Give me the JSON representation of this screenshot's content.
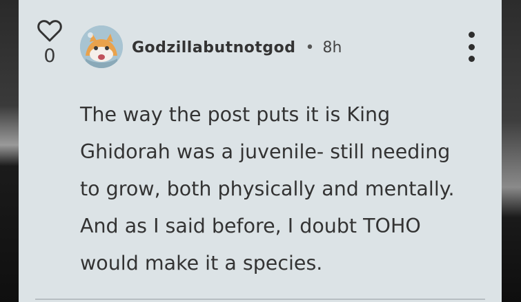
{
  "comment": {
    "like_count": "0",
    "username": "Godzillabutnotgod",
    "separator": "•",
    "time": "8h",
    "text_lines": [
      "The way the post puts it is King",
      "Ghidorah was a juvenile- still needing",
      "to grow, both physically and mentally.",
      "And as I said before, I doubt TOHO",
      "would make it a species."
    ]
  },
  "icons": {
    "like": "heart-outline-icon",
    "more": "vertical-ellipsis-icon",
    "avatar": "user-avatar"
  },
  "colors": {
    "card_background": "#dce3e6",
    "text": "#333333"
  }
}
